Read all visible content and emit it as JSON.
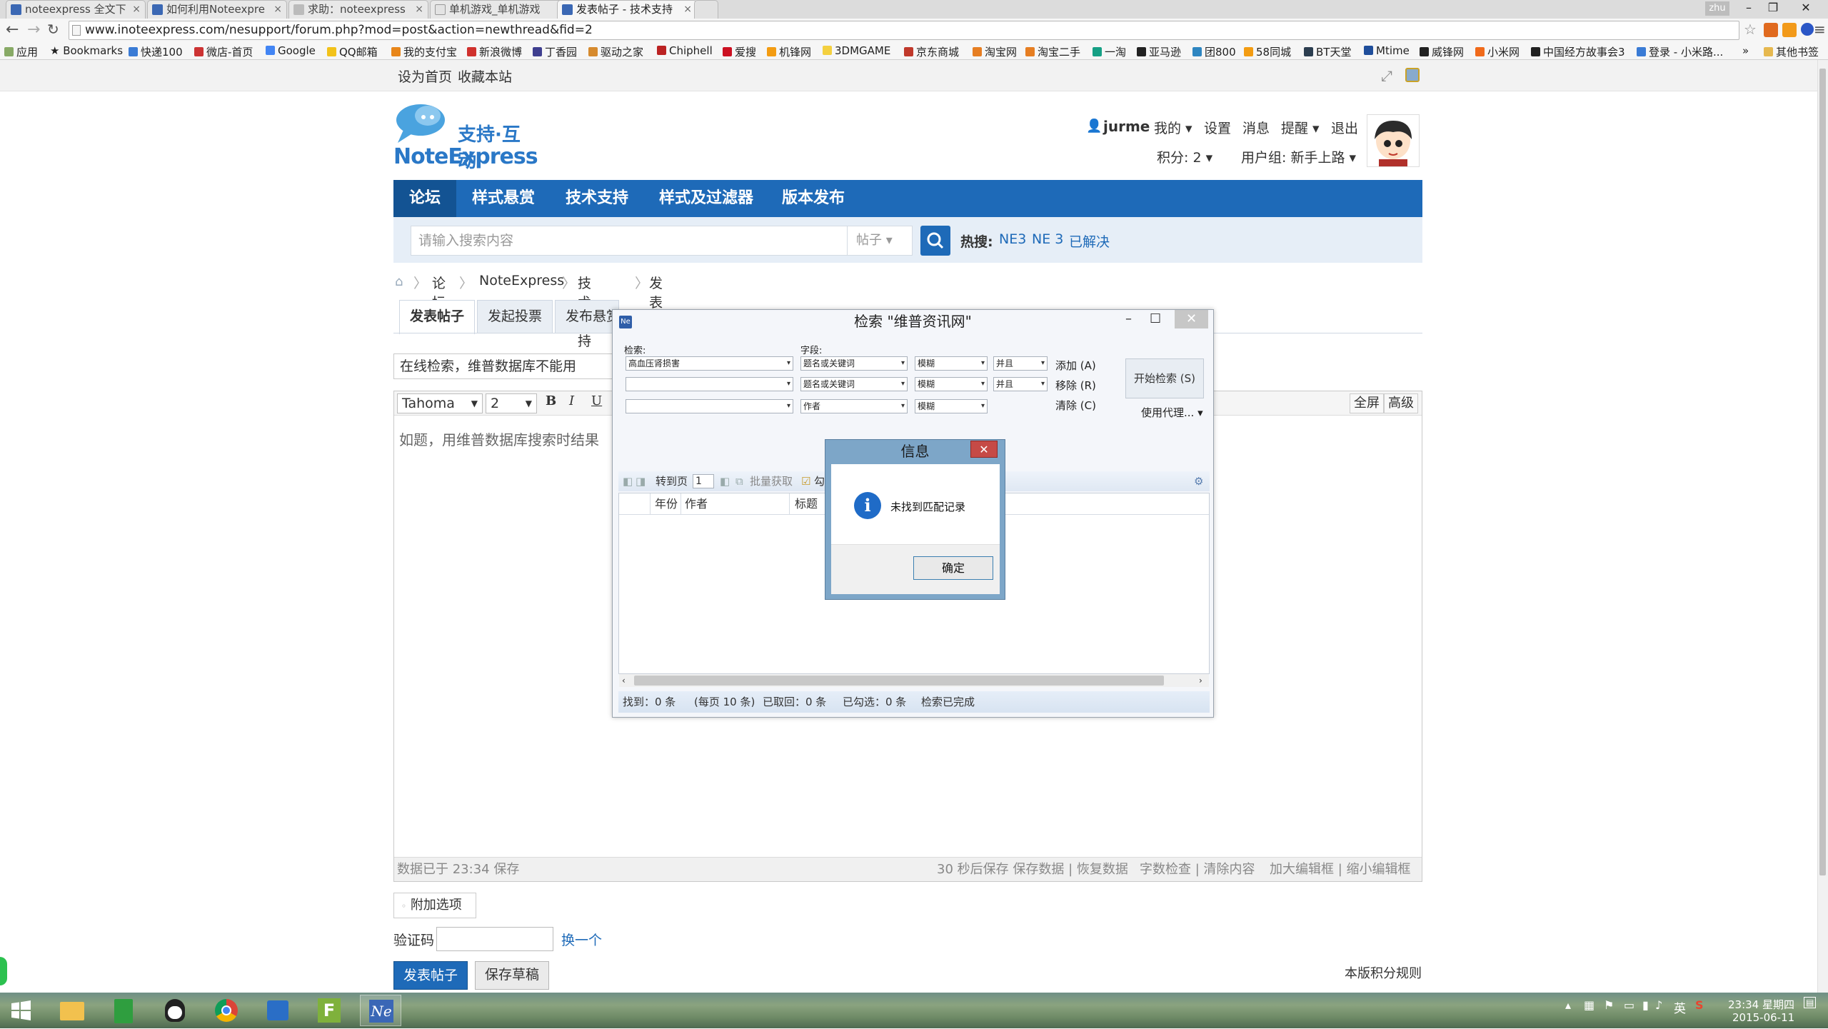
{
  "browser": {
    "tabs": [
      {
        "label": "noteexpress 全文下"
      },
      {
        "label": "如何利用Noteexpre"
      },
      {
        "label": "求助：noteexpress"
      },
      {
        "label": "单机游戏_单机游戏"
      },
      {
        "label": "发表帖子 - 技术支持"
      }
    ],
    "profile": "zhu",
    "url": "www.inoteexpress.com/nesupport/forum.php?mod=post&action=newthread&fid=2",
    "bookmarks": [
      "应用",
      "Bookmarks",
      "快递100",
      "微店-首页",
      "Google",
      "QQ邮箱",
      "我的支付宝",
      "新浪微博",
      "丁香园",
      "驱动之家",
      "Chiphell",
      "爱搜",
      "机锋网",
      "3DMGAME",
      "京东商城",
      "淘宝网",
      "淘宝二手",
      "一淘",
      "亚马逊",
      "团800",
      "58同城",
      "BT天堂",
      "Mtime",
      "威锋网",
      "小米网",
      "中国经方故事会3",
      "登录 - 小米路...",
      "»",
      "其他书签"
    ],
    "colors": {
      "accent": "#1e6ab8"
    }
  },
  "site": {
    "top_links": [
      "设为首页",
      "收藏本站"
    ],
    "logo_top": "支持·互动",
    "logo_bottom": "NoteExpress",
    "user": {
      "name": "jurme",
      "links": [
        "我的",
        "设置",
        "消息",
        "提醒",
        "退出"
      ],
      "points": "积分: 2",
      "group": "用户组: 新手上路"
    },
    "nav": [
      "论坛",
      "样式悬赏",
      "技术支持",
      "样式及过滤器",
      "版本发布"
    ],
    "search": {
      "placeholder": "请输入搜索内容",
      "type": "帖子",
      "hot_label": "热搜:",
      "hot_terms": [
        "NE3",
        "NE 3",
        "已解决"
      ]
    },
    "breadcrumb": [
      "论坛",
      "NoteExpress",
      "技术支持",
      "发表帖子"
    ],
    "post_tabs": [
      "发表帖子",
      "发起投票",
      "发布悬赏"
    ],
    "subject": "在线检索，维普数据库不能用",
    "editor": {
      "font": "Tahoma",
      "size": "2",
      "bold": "B",
      "italic": "I",
      "underline": "U",
      "fullscreen": "全屏",
      "advanced": "高级",
      "body": "如题，用维普数据库搜索时结果",
      "saved_status": "数据已于 23:34 保存",
      "footer_links": [
        "30 秒后保存 保存数据 | 恢复数据",
        "字数检查 | 清除内容",
        "加大编辑框 | 缩小编辑框"
      ]
    },
    "extra_options": "附加选项",
    "captcha_label": "验证码",
    "captcha_change": "换一个",
    "submit": "发表帖子",
    "save_draft": "保存草稿",
    "rules": "本版积分规则"
  },
  "ne_window": {
    "title": "检索 \"维普资讯网\"",
    "search_label": "检索:",
    "field_label": "字段:",
    "rows": [
      {
        "term": "高血压肾损害",
        "field": "题名或关键词",
        "match": "模糊",
        "logic": "并且"
      },
      {
        "term": "",
        "field": "题名或关键词",
        "match": "模糊",
        "logic": "并且"
      },
      {
        "term": "",
        "field": "作者",
        "match": "模糊",
        "logic": ""
      }
    ],
    "add": "添加 (A)",
    "remove": "移除 (R)",
    "clear": "清除 (C)",
    "start": "开始检索 (S)",
    "proxy": "使用代理...",
    "toolbar": {
      "goto": "转到页",
      "page": "1",
      "batch": "批量获取",
      "check": "勾"
    },
    "columns": [
      "年份",
      "作者",
      "标题"
    ],
    "status": {
      "found": "找到：0 条",
      "per_page": "(每页 10 条)",
      "retrieved": "已取回：0 条",
      "checked": "已勾选：0 条",
      "state": "检索已完成"
    }
  },
  "dialog": {
    "title": "信息",
    "message": "未找到匹配记录",
    "ok": "确定"
  },
  "taskbar": {
    "time": "23:34 星期四",
    "date": "2015-06-11",
    "ime": "英"
  }
}
